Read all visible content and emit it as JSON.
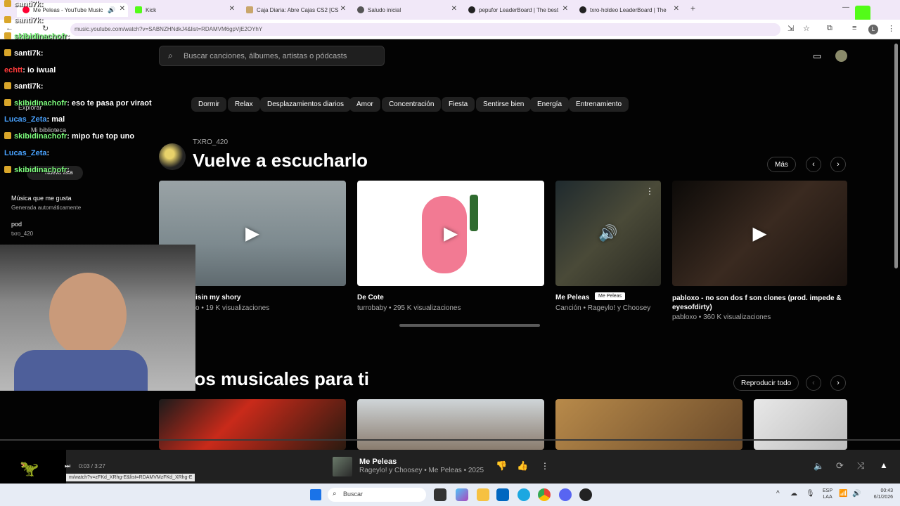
{
  "browser": {
    "tabs": [
      {
        "label": "Me Peleas - YouTube Music",
        "active": true
      },
      {
        "label": "Kick"
      },
      {
        "label": "Caja Diaria: Abre Cajas CS2 [CS"
      },
      {
        "label": "Saludo inicial"
      },
      {
        "label": "pepufor LeaderBoard | The best"
      },
      {
        "label": "txro-holdeo LeaderBoard | The"
      }
    ],
    "url": "music.youtube.com/watch?v=SABNZHNdkJ4&list=RDAMVM6gpVjE2OYhY",
    "new_tab": "+",
    "profile_initial": "L"
  },
  "search": {
    "placeholder": "Buscar canciones, álbumes, artistas o pódcasts"
  },
  "chips": [
    "Dormir",
    "Relax",
    "Desplazamientos diarios",
    "Amor",
    "Concentración",
    "Fiesta",
    "Sentirse bien",
    "Energía",
    "Entrenamiento"
  ],
  "sidebar": {
    "explore": "Explorar",
    "library": "Mi biblioteca",
    "new_list": "Nueva lista",
    "playlists": [
      {
        "title": "Música que me gusta",
        "subtitle": "Generada automáticamente"
      },
      {
        "title": "pod",
        "subtitle": "txro_420"
      }
    ]
  },
  "section1": {
    "owner": "TXRO_420",
    "title": "Vuelve a escucharlo",
    "more": "Más",
    "cards": [
      {
        "title": "isin my shory",
        "subtitle": "o • 19 K visualizaciones"
      },
      {
        "title": "De Cote",
        "subtitle": "turrobaby • 295 K visualizaciones"
      },
      {
        "title": "Me Peleas",
        "subtitle": "Canción • Rageylo! y Choosey",
        "tooltip": "Me Peleas"
      },
      {
        "title": "pabloxo - no son dos f son clones (prod. impede & eyesofdirty)",
        "subtitle": "pabloxo • 360 K visualizaciones"
      }
    ]
  },
  "section2": {
    "title": "eos musicales para ti",
    "play_all": "Reproducir todo"
  },
  "chat": [
    {
      "user": "santi7k",
      "msg": ":",
      "color": "#ffffff"
    },
    {
      "user": "santi7k",
      "msg": ":",
      "color": "#ffffff"
    },
    {
      "user": "skibidinachofr",
      "msg": ":",
      "color": "#7cfc7c"
    },
    {
      "user": "santi7k",
      "msg": ":",
      "color": "#ffffff"
    },
    {
      "user": "echtt",
      "msg": ": io iwual",
      "color": "#ff3b3b"
    },
    {
      "user": "santi7k",
      "msg": ":",
      "color": "#ffffff"
    },
    {
      "user": "skibidinachofr",
      "msg": ": eso te pasa por viraot",
      "color": "#7cfc7c"
    },
    {
      "user": "Lucas_Zeta",
      "msg": ": mal",
      "color": "#4aa3ff"
    },
    {
      "user": "skibidinachofr",
      "msg": ": mipo fue top uno",
      "color": "#7cfc7c"
    },
    {
      "user": "Lucas_Zeta",
      "msg": ":",
      "color": "#4aa3ff"
    },
    {
      "user": "skibidinachofr",
      "msg": ":",
      "color": "#7cfc7c"
    }
  ],
  "player": {
    "time": "0:03 / 3:27",
    "title": "Me Peleas",
    "subtitle": "Rageylo! y Choosey • Me Peleas • 2025",
    "status_url": "m/watch?v=zFKd_XRhg-E&list=RDAMVMzFKd_XRhg-E"
  },
  "taskbar": {
    "search": "Buscar",
    "lang": "ESP",
    "lang2": "LAA",
    "time": "00:43",
    "date": "6/1/2026"
  },
  "colors": {
    "accent": "#ff0033",
    "page_bg": "#030303",
    "chip_bg": "#212121"
  }
}
